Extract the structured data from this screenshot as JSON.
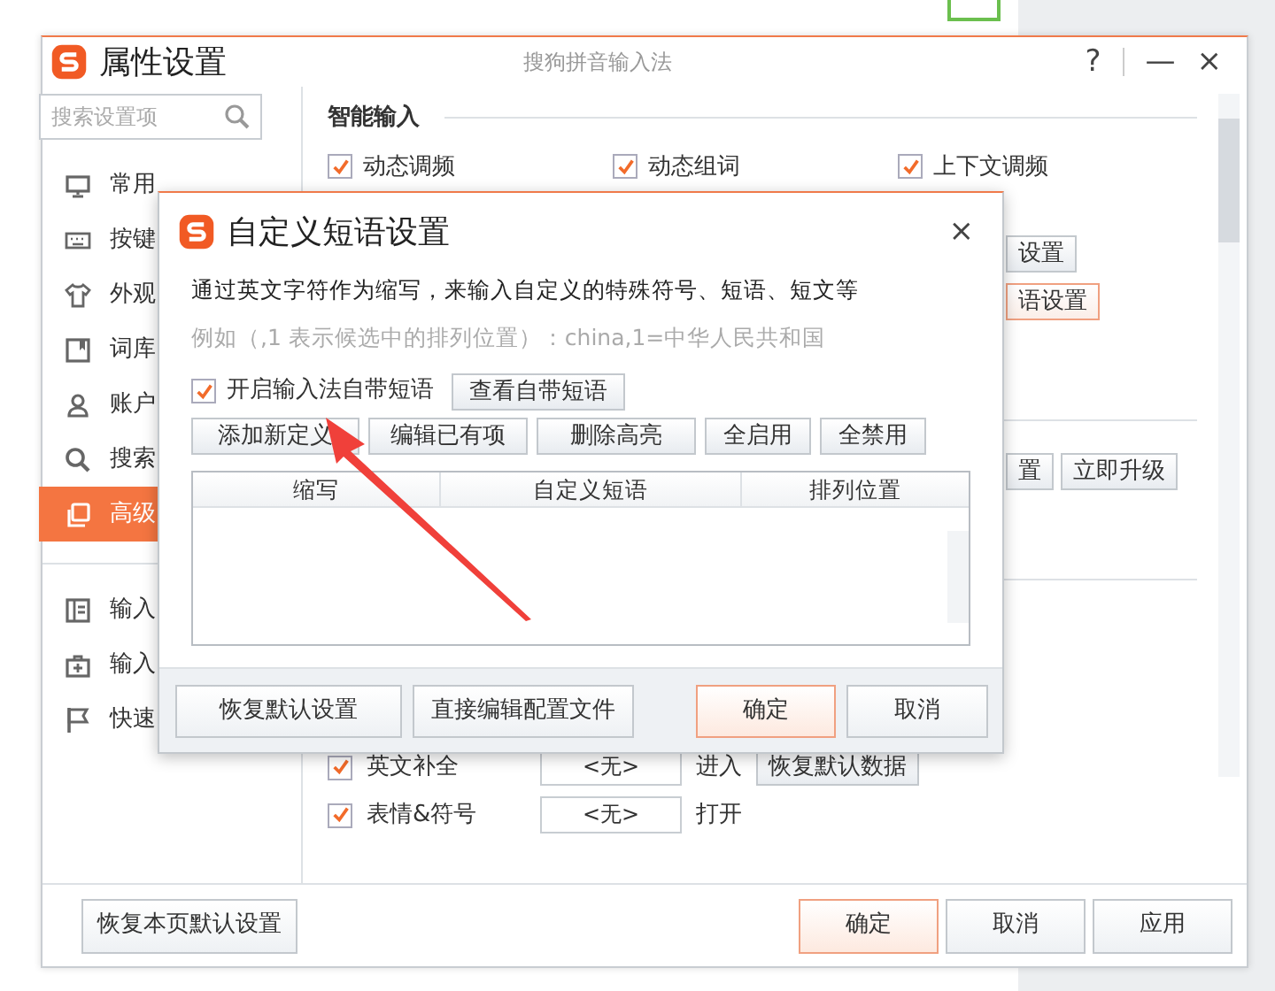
{
  "window": {
    "title": "属性设置",
    "app_name": "搜狗拼音输入法",
    "help": "?",
    "minimize": "—",
    "close": "×"
  },
  "sidebar": {
    "search_placeholder": "搜索设置项",
    "items": [
      {
        "label": "常用",
        "selected": false
      },
      {
        "label": "按键",
        "selected": false
      },
      {
        "label": "外观",
        "selected": false
      },
      {
        "label": "词库",
        "selected": false
      },
      {
        "label": "账户",
        "selected": false
      },
      {
        "label": "搜索",
        "selected": false
      },
      {
        "label": "高级",
        "selected": true
      }
    ],
    "lower_items": [
      {
        "label": "输入"
      },
      {
        "label": "输入"
      },
      {
        "label": "快速"
      }
    ]
  },
  "content": {
    "section_title": "智能输入",
    "checkboxes": [
      {
        "label": "动态调频",
        "checked": true
      },
      {
        "label": "动态组词",
        "checked": true
      },
      {
        "label": "上下文调频",
        "checked": true
      }
    ],
    "side_buttons": [
      {
        "label": "设置",
        "highlighted": false
      },
      {
        "label": "语设置",
        "highlighted": true
      }
    ],
    "upgrade_buttons": [
      "置",
      "立即升级"
    ],
    "rows": [
      {
        "label": "英文补全",
        "checked": true,
        "hotkey": "<无>",
        "action": "进入",
        "button": "恢复默认数据"
      },
      {
        "label": "表情&符号",
        "checked": true,
        "hotkey": "<无>",
        "action": "打开"
      }
    ]
  },
  "footer": {
    "reset": "恢复本页默认设置",
    "buttons": [
      {
        "label": "确定",
        "primary": true
      },
      {
        "label": "取消",
        "primary": false
      },
      {
        "label": "应用",
        "primary": false
      }
    ]
  },
  "dialog": {
    "title": "自定义短语设置",
    "close": "×",
    "description": "通过英文字符作为缩写，来输入自定义的特殊符号、短语、短文等",
    "example": "例如（,1 表示候选中的排列位置）：china,1=中华人民共和国",
    "builtin": {
      "label": "开启输入法自带短语",
      "checked": true,
      "button": "查看自带短语"
    },
    "actions": [
      "添加新定义",
      "编辑已有项",
      "删除高亮",
      "全启用",
      "全禁用"
    ],
    "columns": [
      "缩写",
      "自定义短语",
      "排列位置"
    ],
    "footer_buttons": [
      {
        "label": "恢复默认设置",
        "primary": false
      },
      {
        "label": "直接编辑配置文件",
        "primary": false
      },
      {
        "label": "确定",
        "primary": true
      },
      {
        "label": "取消",
        "primary": false
      }
    ]
  }
}
